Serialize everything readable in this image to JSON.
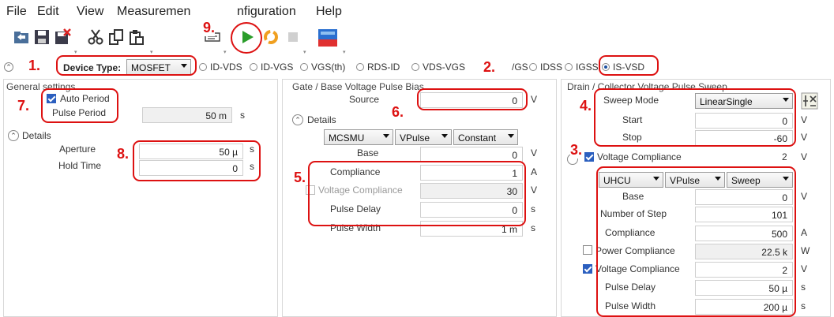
{
  "menu": {
    "file": "File",
    "edit": "Edit",
    "view": "View",
    "measurement": "Measuremen",
    "configuration": "nfiguration",
    "help": "Help"
  },
  "callouts": {
    "n1": "1.",
    "n2": "2.",
    "n3": "3.",
    "n4": "4.",
    "n5": "5.",
    "n6": "6.",
    "n7": "7.",
    "n8": "8.",
    "n9": "9."
  },
  "device": {
    "label": "Device Type:",
    "value": "MOSFET",
    "tests": [
      {
        "label": "ID-VDS",
        "selected": false
      },
      {
        "label": "ID-VGS",
        "selected": false
      },
      {
        "label": "VGS(th)",
        "selected": false
      },
      {
        "label": "RDS-ID",
        "selected": false
      },
      {
        "label": "VDS-VGS",
        "selected": false
      },
      {
        "label": "/GS",
        "selected": false
      },
      {
        "label": "IDSS",
        "selected": false
      },
      {
        "label": "IGSS",
        "selected": false
      },
      {
        "label": "IS-VSD",
        "selected": true
      }
    ]
  },
  "general": {
    "title": "General settings",
    "auto_period": "Auto Period",
    "pulse_period_label": "Pulse Period",
    "pulse_period_value": "50 m",
    "pulse_period_unit": "s",
    "details": "Details",
    "aperture_label": "Aperture",
    "aperture_value": "50 µ",
    "aperture_unit": "s",
    "hold_time_label": "Hold Time",
    "hold_time_value": "0",
    "hold_time_unit": "s"
  },
  "gate": {
    "title": "Gate / Base Voltage Pulse Bias",
    "source_label": "Source",
    "source_value": "0",
    "source_unit": "V",
    "details": "Details",
    "smu": "MCSMU",
    "pulse": "VPulse",
    "mode": "Constant",
    "base_label": "Base",
    "base_value": "0",
    "base_unit": "V",
    "compliance_label": "Compliance",
    "compliance_value": "1",
    "compliance_unit": "A",
    "vcomp_label": "Voltage Compliance",
    "vcomp_value": "30",
    "vcomp_unit": "V",
    "pulse_delay_label": "Pulse Delay",
    "pulse_delay_value": "0",
    "pulse_delay_unit": "s",
    "pulse_width_label": "Pulse Width",
    "pulse_width_value": "1 m",
    "pulse_width_unit": "s"
  },
  "drain": {
    "title": "Drain / Collector Voltage Pulse Sweep",
    "sweep_mode_label": "Sweep Mode",
    "sweep_mode_value": "LinearSingle",
    "start_label": "Start",
    "start_value": "0",
    "start_unit": "V",
    "stop_label": "Stop",
    "stop_value": "-60",
    "stop_unit": "V",
    "vcomp_label": "Voltage Compliance",
    "vcomp_value": "2",
    "vcomp_unit": "V",
    "smu": "UHCU",
    "pulse": "VPulse",
    "mode": "Sweep",
    "base_label": "Base",
    "base_value": "0",
    "base_unit": "V",
    "steps_label": "Number of Step",
    "steps_value": "101",
    "compliance_label": "Compliance",
    "compliance_value": "500",
    "compliance_unit": "A",
    "power_label": "Power Compliance",
    "power_value": "22.5 k",
    "power_unit": "W",
    "vcomp2_label": "Voltage Compliance",
    "vcomp2_value": "2",
    "vcomp2_unit": "V",
    "pulse_delay_label": "Pulse Delay",
    "pulse_delay_value": "50 µ",
    "pulse_delay_unit": "s",
    "pulse_width_label": "Pulse Width",
    "pulse_width_value": "200 µ",
    "pulse_width_unit": "s"
  },
  "colors": {
    "callout": "#dd1111",
    "run": "#2a9d2a",
    "selected_radio": "#1a4fa0"
  },
  "icons": [
    "open-icon",
    "save-icon",
    "export-icon",
    "cut-icon",
    "copy-icon",
    "paste-icon",
    "comment-icon",
    "run-icon",
    "repeat-icon",
    "stop-icon",
    "graph-icon",
    "table-add-icon"
  ]
}
